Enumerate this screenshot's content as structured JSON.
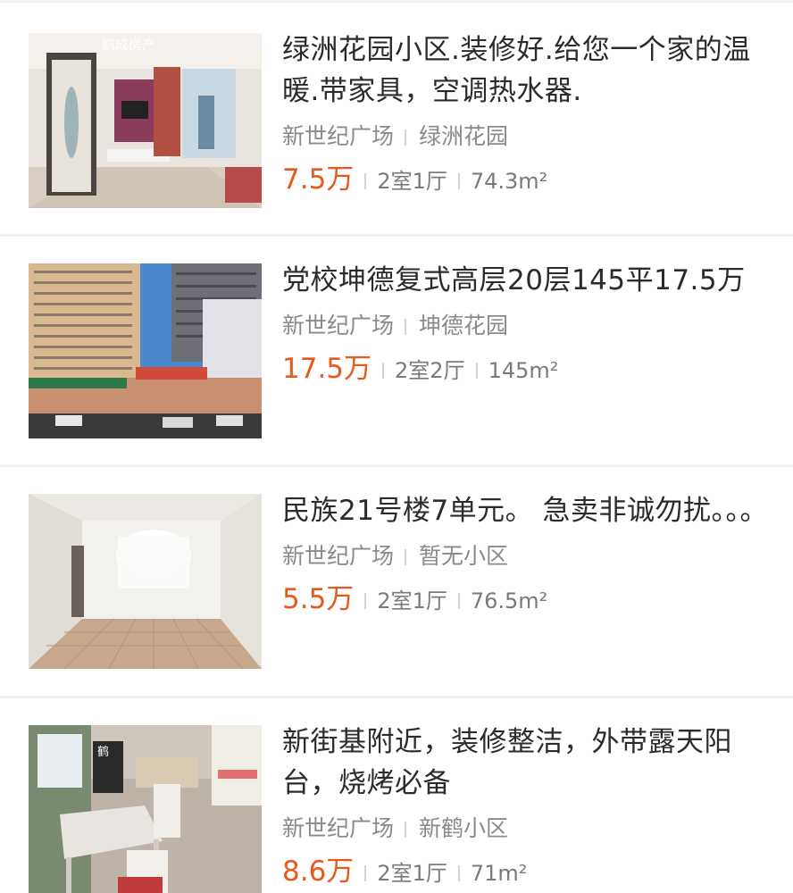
{
  "listings": [
    {
      "title": "绿洲花园小区.装修好.给您一个家的温暖.带家具，空调热水器.",
      "area": "新世纪广场",
      "community": "绿洲花园",
      "price": "7.5万",
      "layout": "2室1厅",
      "size": "74.3m²",
      "thumb_watermark": "鹤成房产"
    },
    {
      "title": "党校坤德复式高层20层145平17.5万",
      "area": "新世纪广场",
      "community": "坤德花园",
      "price": "17.5万",
      "layout": "2室2厅",
      "size": "145m²"
    },
    {
      "title": "民族21号楼7单元。 急卖非诚勿扰。。。",
      "area": "新世纪广场",
      "community": "暂无小区",
      "price": "5.5万",
      "layout": "2室1厅",
      "size": "76.5m²"
    },
    {
      "title": "新街基附近，装修整洁，外带露天阳台，烧烤必备",
      "area": "新世纪广场",
      "community": "新鹤小区",
      "price": "8.6万",
      "layout": "2室1厅",
      "size": "71m²",
      "thumb_watermark": "鹤"
    }
  ],
  "colors": {
    "price": "#e8591d",
    "title": "#2b2b2b",
    "meta": "#8a8a8a",
    "separator": "#efefef"
  }
}
